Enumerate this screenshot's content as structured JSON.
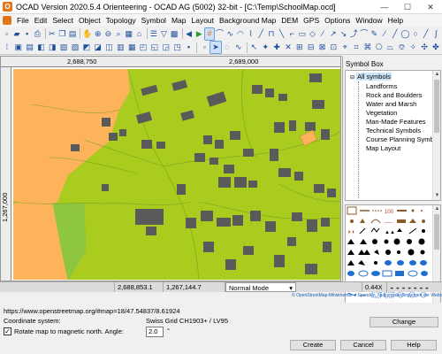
{
  "window": {
    "title": "OCAD Version 2020.5.4 Orienteering - OCAD AG (5002) 32-bit - [C:\\Temp\\SchoolMap.ocd]",
    "controls": [
      "—",
      "☐",
      "✕"
    ]
  },
  "menu": [
    "File",
    "Edit",
    "Select",
    "Object",
    "Topology",
    "Symbol",
    "Map",
    "Layout",
    "Background Map",
    "DEM",
    "GPS",
    "Options",
    "Window",
    "Help"
  ],
  "ruler": {
    "top_labels": [
      "2,688,750",
      "2,689,000"
    ],
    "left_label": "1,267,000"
  },
  "symbol_box": {
    "title": "Symbol Box",
    "root": "All symbols",
    "items": [
      "Landforms",
      "Rock and Boulders",
      "Water and Marsh",
      "Vegetation",
      "Man-Made Features",
      "Technical Symbols",
      "Course Planning Symbols",
      "Map Layout"
    ]
  },
  "status": {
    "coords": "2,688,853.1",
    "coords2": "1,267,144.7",
    "mode": "Normal Mode",
    "zoom": "0.44X"
  },
  "attribution": "© OpenStreetMap-Mitwirkende ● Spenden, Nutzungsbedingungen der Website und API",
  "dialog": {
    "url": "https://www.openstreetmap.org/#map=18/47.54837/8.61924",
    "coord_label": "Coordinate system:",
    "coord_value": "Swiss Grid  CH1903+ / LV95",
    "change_button": "Change",
    "rotate_label": "Rotate map to magnetic north. Angle:",
    "rotate_checked": true,
    "angle": "2.0",
    "degree": "°",
    "create_button": "Create",
    "cancel_button": "Cancel",
    "help_button": "Help"
  },
  "colors": {
    "open_land": "#fdb35a",
    "forest": "#a9cc1f",
    "rough_green": "#8ec63f",
    "building": "#5a5a5a",
    "background": "#f0f0f0"
  }
}
